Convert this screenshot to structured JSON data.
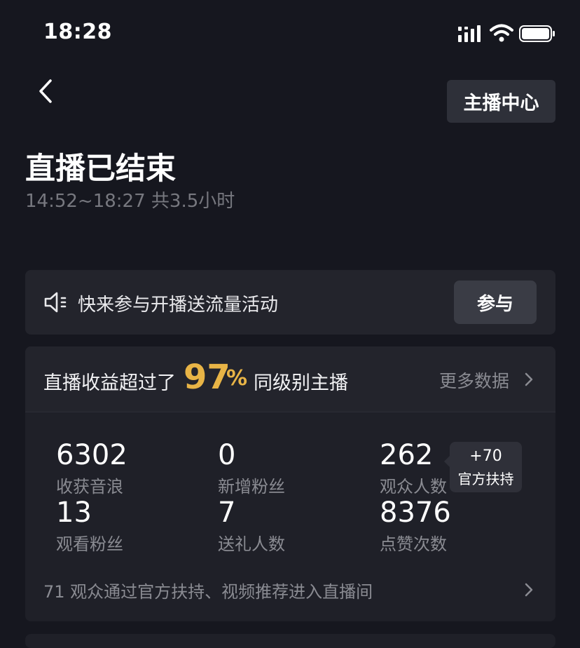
{
  "status_bar": {
    "time": "18:28"
  },
  "header": {
    "anchor_center_label": "主播中心"
  },
  "summary": {
    "title": "直播已结束",
    "time_range": "14:52~18:27 共3.5小时"
  },
  "activity": {
    "text": "快来参与开播送流量活动",
    "join_label": "参与"
  },
  "ranking": {
    "prefix": "直播收益超过了",
    "percent": "97",
    "unit": "%",
    "suffix": "同级别主播",
    "more_label": "更多数据"
  },
  "stats": [
    {
      "value": "6302",
      "label": "收获音浪"
    },
    {
      "value": "0",
      "label": "新增粉丝"
    },
    {
      "value": "262",
      "label": "观众人数"
    },
    {
      "value": "13",
      "label": "观看粉丝"
    },
    {
      "value": "7",
      "label": "送礼人数"
    },
    {
      "value": "8376",
      "label": "点赞次数"
    }
  ],
  "official_support": {
    "value": "+70",
    "label": "官方扶持"
  },
  "footer": {
    "text": "71 观众通过官方扶持、视频推荐进入直播间"
  },
  "colors": {
    "background": "#16171f",
    "card": "#23242c",
    "accent": "#e8b446"
  },
  "icons": {
    "signal": "cellular-signal-icon",
    "wifi": "wifi-icon",
    "battery": "battery-icon",
    "back": "chevron-left-icon",
    "speaker": "speaker-icon",
    "chevron": "chevron-right-icon"
  }
}
